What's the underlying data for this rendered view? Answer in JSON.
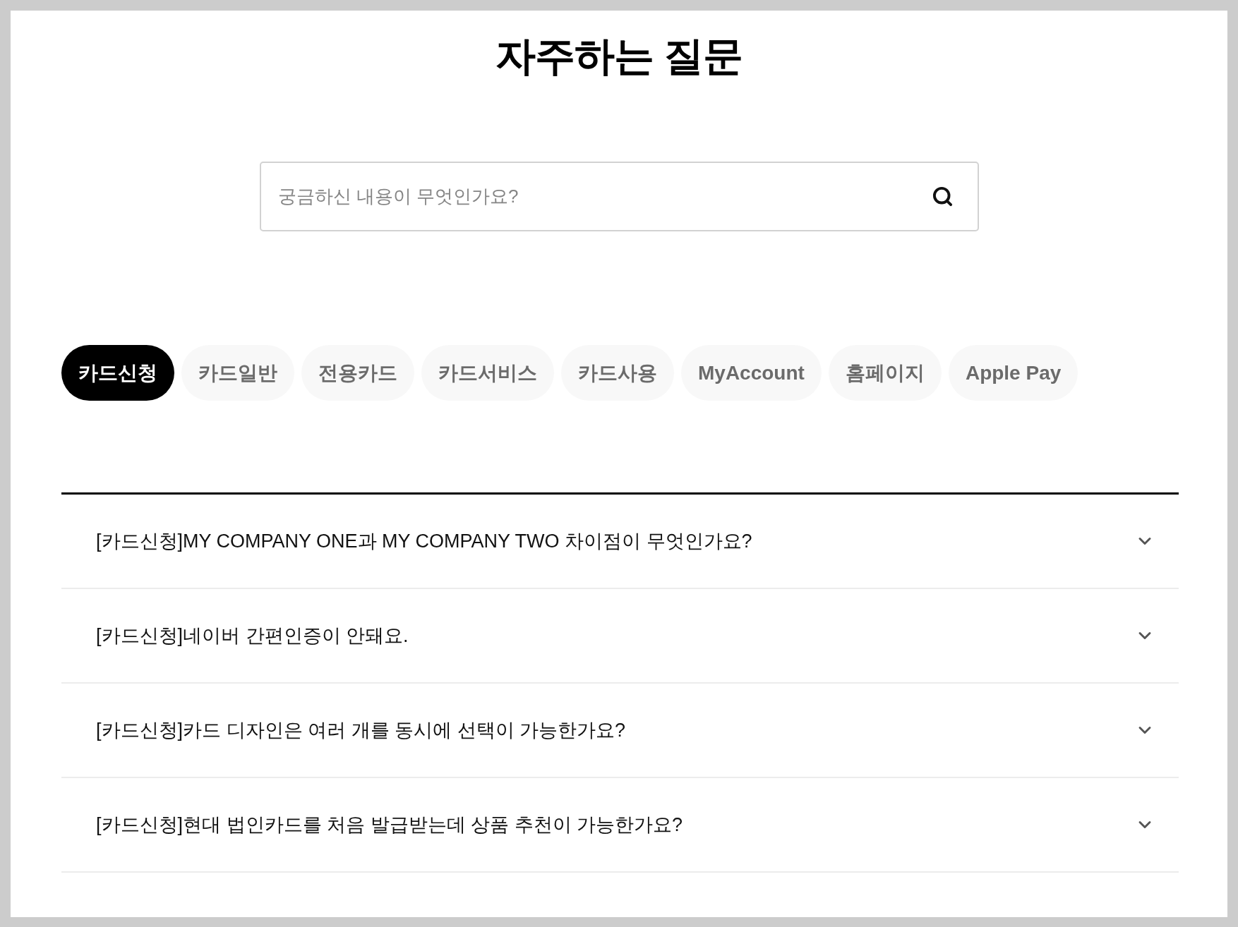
{
  "page": {
    "title": "자주하는 질문"
  },
  "search": {
    "placeholder": "궁금하신 내용이 무엇인가요?"
  },
  "tabs": [
    {
      "label": "카드신청",
      "selected": true
    },
    {
      "label": "카드일반",
      "selected": false
    },
    {
      "label": "전용카드",
      "selected": false
    },
    {
      "label": "카드서비스",
      "selected": false
    },
    {
      "label": "카드사용",
      "selected": false
    },
    {
      "label": "MyAccount",
      "selected": false
    },
    {
      "label": "홈페이지",
      "selected": false
    },
    {
      "label": "Apple Pay",
      "selected": false
    }
  ],
  "faq": [
    {
      "question": "[카드신청]MY COMPANY ONE과 MY COMPANY TWO 차이점이 무엇인가요?",
      "expanded": false
    },
    {
      "question": "[카드신청]네이버 간편인증이 안돼요.",
      "expanded": false
    },
    {
      "question": "[카드신청]카드 디자인은 여러 개를 동시에 선택이 가능한가요?",
      "expanded": false
    },
    {
      "question": "[카드신청]현대 법인카드를 처음 발급받는데 상품 추천이 가능한가요?",
      "expanded": false
    }
  ]
}
